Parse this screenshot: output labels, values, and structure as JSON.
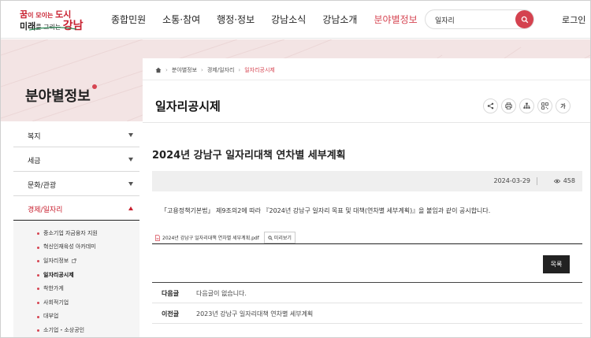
{
  "header": {
    "logo": {
      "line1_prefix": "꿈",
      "line1_rest": "이 모이는 ",
      "line1_big": "도시",
      "line2_prefix": "미래",
      "line2_mid": "를 그리는 ",
      "line2_big": "강남"
    },
    "nav": [
      "종합민원",
      "소통·참여",
      "행정·정보",
      "강남소식",
      "강남소개",
      "분야별정보"
    ],
    "nav_active_index": 5,
    "search": {
      "value": "일자리",
      "icon": "search-icon"
    },
    "login": "로그인"
  },
  "sidebar": {
    "title": "분야별정보",
    "items": [
      {
        "label": "복지",
        "expanded": false
      },
      {
        "label": "세금",
        "expanded": false
      },
      {
        "label": "문화/관광",
        "expanded": false
      },
      {
        "label": "경제/일자리",
        "expanded": true
      }
    ],
    "sub_items": [
      {
        "label": "중소기업 자금융자 지원"
      },
      {
        "label": "혁신인재육성 아카데미"
      },
      {
        "label": "일자리정보"
      },
      {
        "label": "일자리공시제",
        "current": true
      },
      {
        "label": "착한가게"
      },
      {
        "label": "사회적기업"
      },
      {
        "label": "대부업"
      },
      {
        "label": "소기업・소상공인"
      }
    ]
  },
  "breadcrumb": {
    "home_icon": "home-icon",
    "items": [
      "분야별정보",
      "경제/일자리",
      "일자리공시제"
    ]
  },
  "page": {
    "title": "일자리공시제",
    "tools": [
      "share-icon",
      "print-icon",
      "sitemap-icon",
      "qr-code-icon"
    ],
    "font_tool": "가"
  },
  "post": {
    "title": "2024년 강남구 일자리대책 연차별 세부계획",
    "date": "2024-03-29",
    "views": "458",
    "body": "「고용정책기본법」 제9조의2에 따라 『2024년 강남구 일자리 목표 및 대책(연차별 세부계획)』을 붙임과 같이 공시합니다.",
    "attachment": {
      "filename": "2024년 강남구 일자리대책 연차별 세부계획.pdf",
      "preview": "미리보기"
    },
    "list_button": "목록",
    "next": {
      "label": "다음글",
      "text": "다음글이 없습니다."
    },
    "prev": {
      "label": "이전글",
      "text": "2023년 강남구 일자리대책 연차별 세부계획"
    }
  },
  "colors": {
    "accent": "#d64552",
    "band": "#f3e4e4",
    "dark_button": "#222222"
  }
}
